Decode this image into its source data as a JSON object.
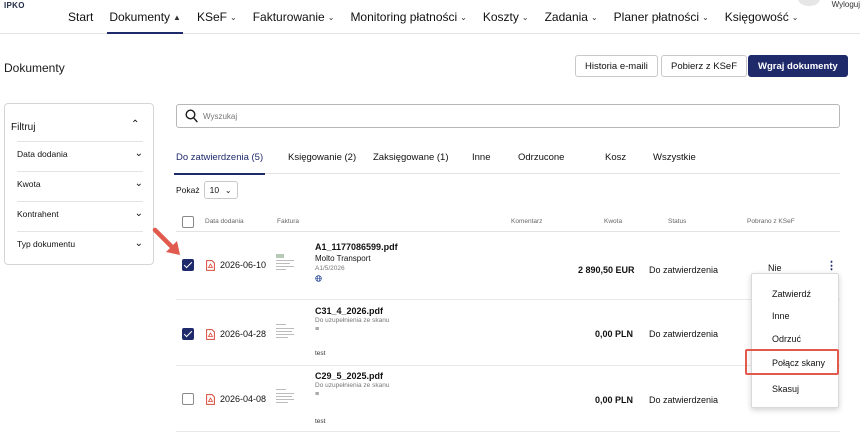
{
  "app": {
    "logo": "IPKO",
    "user_label": "Wyloguj"
  },
  "nav": {
    "items": [
      {
        "label": "Start",
        "dropdown": false,
        "active": false
      },
      {
        "label": "Dokumenty",
        "dropdown": true,
        "active": true
      },
      {
        "label": "KSeF",
        "dropdown": true,
        "active": false
      },
      {
        "label": "Fakturowanie",
        "dropdown": true,
        "active": false
      },
      {
        "label": "Monitoring płatności",
        "dropdown": true,
        "active": false
      },
      {
        "label": "Koszty",
        "dropdown": true,
        "active": false
      },
      {
        "label": "Zadania",
        "dropdown": true,
        "active": false
      },
      {
        "label": "Planer płatności",
        "dropdown": true,
        "active": false
      },
      {
        "label": "Księgowość",
        "dropdown": true,
        "active": false
      }
    ]
  },
  "header": {
    "title": "Dokumenty",
    "buttons": {
      "history": "Historia e-maili",
      "fetch": "Pobierz z KSeF",
      "upload": "Wgraj dokumenty"
    }
  },
  "filters": {
    "title": "Filtruj",
    "items": [
      "Data dodania",
      "Kwota",
      "Kontrahent",
      "Typ dokumentu"
    ]
  },
  "search": {
    "placeholder": "Wyszukaj",
    "value": ""
  },
  "tabs": [
    {
      "label": "Do zatwierdzenia (5)",
      "active": true
    },
    {
      "label": "Księgowanie (2)",
      "active": false
    },
    {
      "label": "Zaksięgowane (1)",
      "active": false
    },
    {
      "label": "Inne",
      "active": false
    },
    {
      "label": "Odrzucone",
      "active": false
    },
    {
      "label": "Kosz",
      "active": false
    },
    {
      "label": "Wszystkie",
      "active": false
    }
  ],
  "page_size": {
    "label": "Pokaż",
    "value": "10"
  },
  "table": {
    "headers": {
      "date": "Data dodania",
      "invoice": "Faktura",
      "comment": "Komentarz",
      "amount": "Kwota",
      "status": "Status",
      "ksef": "Pobrano z KSeF"
    },
    "rows": [
      {
        "checked": true,
        "date": "2026-06-10",
        "file": "A1_1177086599.pdf",
        "line1": "Molto Transport",
        "line2": "A1/5/2026",
        "icon": "globe-icon",
        "comment": "",
        "amount": "2 890,50 EUR",
        "status": "Do zatwierdzenia",
        "ksef": "Nie"
      },
      {
        "checked": true,
        "date": "2026-04-28",
        "file": "C31_4_2026.pdf",
        "line1": "",
        "line2": "Do uzupełnienia ze skanu",
        "icon": "stack-icon",
        "comment": "test",
        "amount": "0,00 PLN",
        "status": "Do zatwierdzenia",
        "ksef": ""
      },
      {
        "checked": false,
        "date": "2026-04-08",
        "file": "C29_5_2025.pdf",
        "line1": "",
        "line2": "Do uzupełnienia ze skanu",
        "icon": "stack-icon",
        "comment": "test",
        "amount": "0,00 PLN",
        "status": "Do zatwierdzenia",
        "ksef": ""
      }
    ]
  },
  "context_menu": {
    "items": [
      "Zatwierdź",
      "Inne",
      "Odrzuć",
      "Połącz skany",
      "Skasuj"
    ],
    "highlighted": "Połącz skany"
  },
  "colors": {
    "brand": "#1f2a6b",
    "highlight": "#e15a4e",
    "pdf": "#d84a3a"
  }
}
